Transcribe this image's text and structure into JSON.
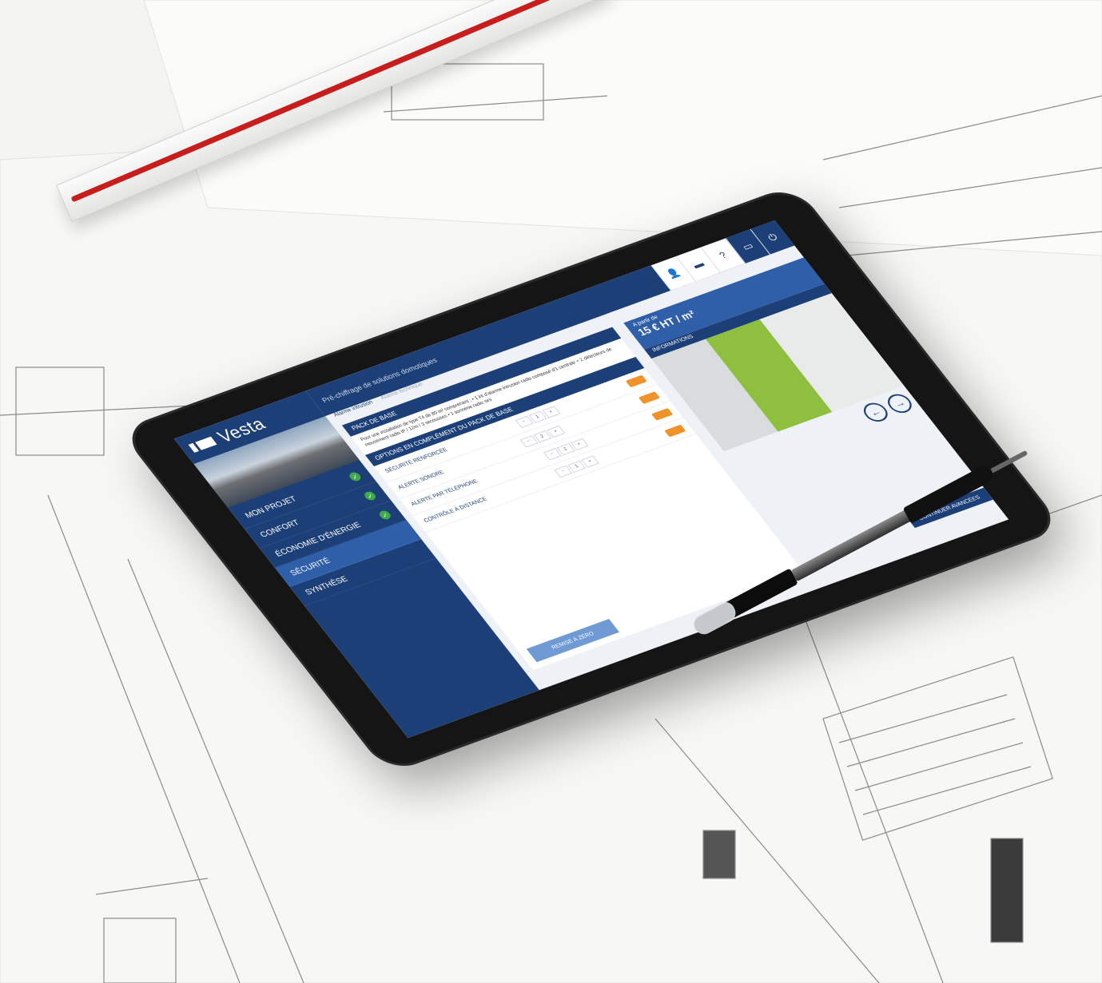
{
  "app": {
    "brand": "Vesta",
    "subtitle": "Pré-chiffrage de solutions domotiques"
  },
  "sidebar": {
    "items": [
      {
        "label": "MON PROJET",
        "done": true
      },
      {
        "label": "CONFORT",
        "done": true
      },
      {
        "label": "ÉCONOMIE D'ÉNERGIE",
        "done": true
      },
      {
        "label": "SÉCURITÉ",
        "done": false,
        "active": true
      },
      {
        "label": "SYNTHÈSE",
        "done": false
      }
    ]
  },
  "tabs": [
    "Alarme intrusion",
    "Alarme technique"
  ],
  "main": {
    "pack_title": "PACK DE BASE",
    "pack_description": "Pour une installation de type T4 de 80 m² comprenant : • 1 kit d'alarme intrusion radio composé d'1 centrale + 2 détecteurs de mouvement radio IP / 12m / 3 secousses • 1 sonnerie radio sirs",
    "options_title": "OPTIONS EN COMPLÉMENT DU PACK DE BASE",
    "options": [
      {
        "label": "SÉCURITÉ RENFORCÉE",
        "qty": "1"
      },
      {
        "label": "ALERTE SONORE",
        "qty": "2"
      },
      {
        "label": "ALERTE PAR TÉLÉPHONE",
        "qty": "1"
      },
      {
        "label": "CONTRÔLE À DISTANCE",
        "qty": "1"
      }
    ],
    "reset_label": "REMISE À ZÉRO"
  },
  "right_panel": {
    "price_from": "A partir de",
    "price_value": "15 € HT / m²",
    "info_title": "INFORMATIONS",
    "continue_label": "CONTINUER AVANCÉES"
  },
  "colors": {
    "navy": "#1c3f78",
    "blue": "#2e5fa8",
    "orange": "#f0922a",
    "green": "#3faa4a",
    "ruler_stripe": "#c81d1d"
  },
  "icons": [
    "user-icon",
    "folder-icon",
    "help-icon",
    "window-icon",
    "power-icon",
    "check-icon",
    "arrow-left-icon",
    "arrow-right-icon"
  ]
}
